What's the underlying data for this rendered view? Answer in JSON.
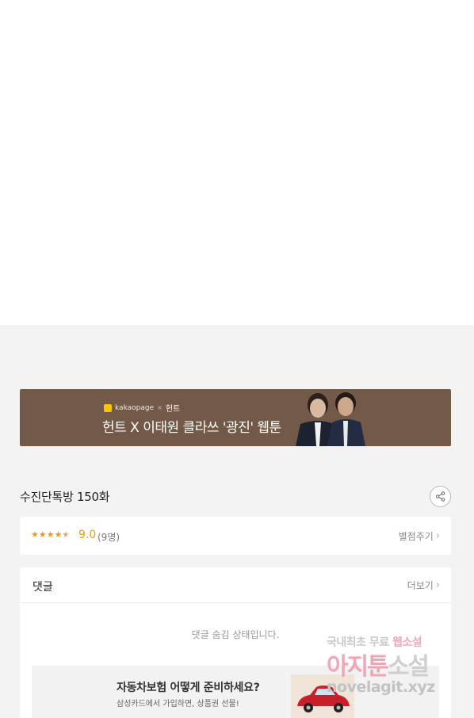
{
  "banner": {
    "brand_kakao": "kakaopage",
    "brand_sep": "×",
    "brand_hunt": "헌트",
    "title": "헌트 X 이태원 클라쓰 '광진' 웹툰",
    "bg_color": "#735a48"
  },
  "episode": {
    "title": "수진단톡방 150화",
    "share_icon": "share-icon"
  },
  "rating": {
    "stars_value": 4.5,
    "stars_max": 5,
    "score": "9.0",
    "count": "(9명)",
    "rate_label": "별점주기",
    "accent_color": "#f29a13"
  },
  "comments": {
    "title": "댓글",
    "more_label": "더보기",
    "hidden_message": "댓글 숨김 상태입니다."
  },
  "ad": {
    "headline": "자동차보험 어떻게 준비하세요?",
    "sub": "삼성카드에서 가입하면, 상품권 선물!"
  },
  "watermark": {
    "line1_a": "국내최초 무료",
    "line1_b": "웹소설",
    "line2_a": "아지툰",
    "line2_b": "소설",
    "line3": "novelagit.xyz"
  }
}
